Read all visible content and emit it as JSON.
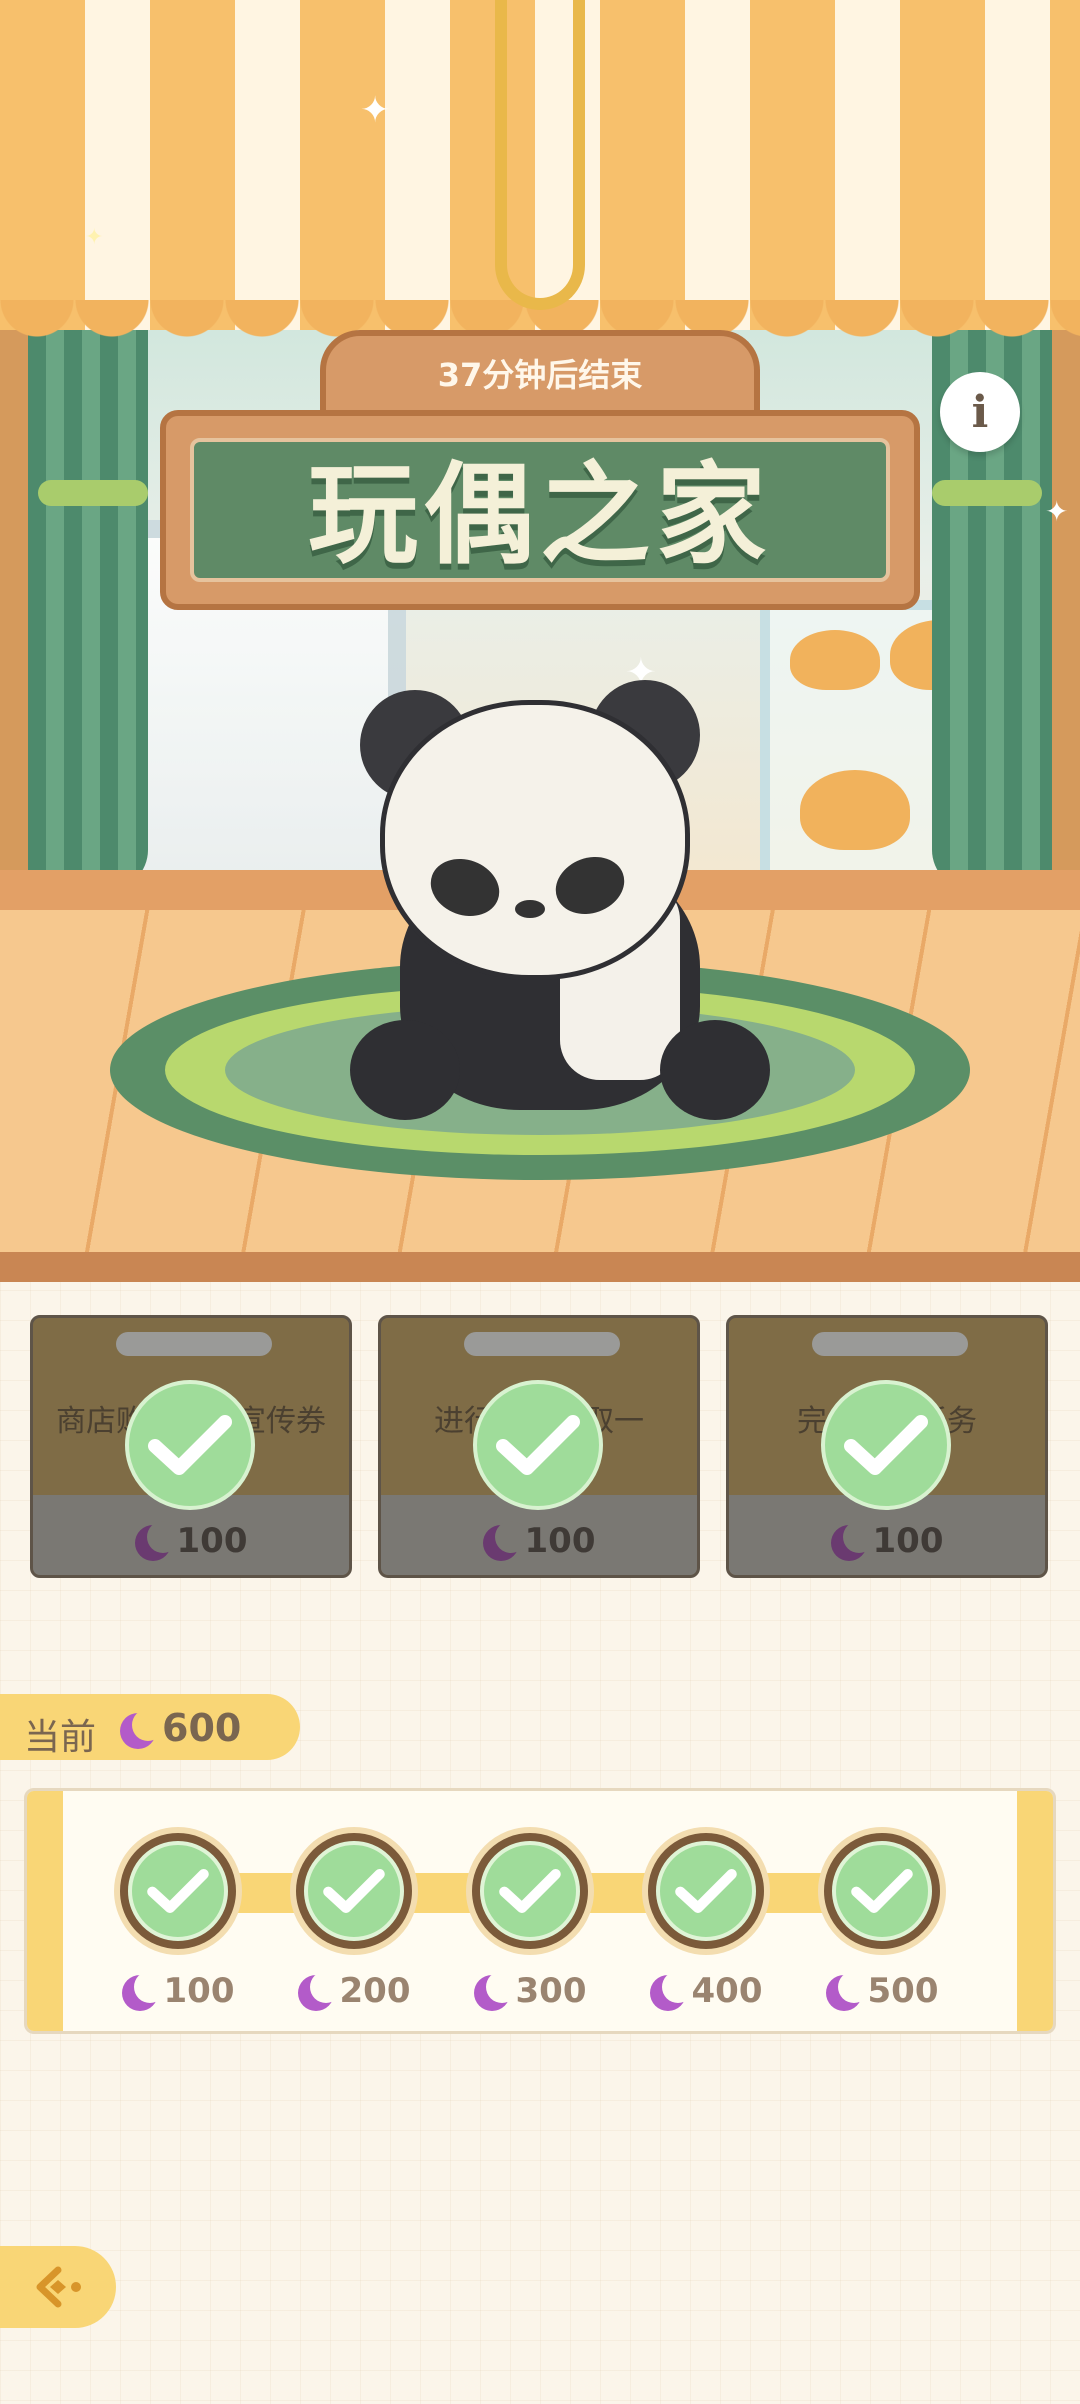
{
  "banner": {
    "timer_text": "37分钟后结束",
    "title": "玩偶之家",
    "info_label": "i"
  },
  "tasks": [
    {
      "text": "商店购买高级宣传券",
      "reward": "100",
      "completed": true
    },
    {
      "text": "进行装扮领取一",
      "reward": "100",
      "completed": true
    },
    {
      "text": "完成每日任务",
      "reward": "100",
      "completed": true
    }
  ],
  "current": {
    "label": "当前",
    "value": "600"
  },
  "milestones": [
    {
      "reward": "100",
      "claimed": true
    },
    {
      "reward": "200",
      "claimed": true
    },
    {
      "reward": "300",
      "claimed": true
    },
    {
      "reward": "400",
      "claimed": true
    },
    {
      "reward": "500",
      "claimed": true
    }
  ],
  "icons": {
    "currency": "moon-icon",
    "check": "check-icon",
    "back": "back-arrow-icon",
    "info": "info-icon"
  },
  "colors": {
    "accent_yellow": "#f9d676",
    "check_green": "#9fdc9a",
    "currency_purple": "#b35bc9",
    "sign_green": "#5f8a66"
  }
}
